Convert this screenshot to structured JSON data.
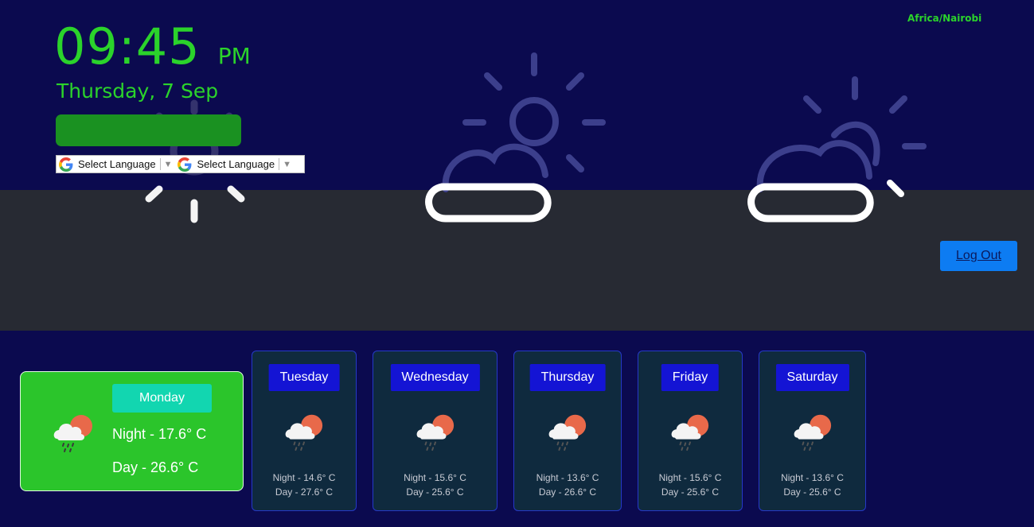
{
  "header": {
    "timezone": "Africa/Nairobi",
    "time": "09:45",
    "ampm": "PM",
    "date": "Thursday, 7 Sep"
  },
  "language": {
    "select1": "Select Language",
    "select2": "Select Language",
    "arrow": "▼"
  },
  "auth": {
    "logout_label": "Log Out"
  },
  "today": {
    "day": "Monday",
    "night": "Night - 17.6° C",
    "day_temp": "Day - 26.6° C",
    "icon": "rain-sun-cloud-icon"
  },
  "forecast": [
    {
      "day": "Tuesday",
      "night": "Night - 14.6° C",
      "day_temp": "Day - 27.6° C"
    },
    {
      "day": "Wednesday",
      "night": "Night - 15.6° C",
      "day_temp": "Day - 25.6° C"
    },
    {
      "day": "Thursday",
      "night": "Night - 13.6° C",
      "day_temp": "Day - 26.6° C"
    },
    {
      "day": "Friday",
      "night": "Night - 15.6° C",
      "day_temp": "Day - 25.6° C"
    },
    {
      "day": "Saturday",
      "night": "Night - 13.6° C",
      "day_temp": "Day - 25.6° C"
    }
  ],
  "colors": {
    "background": "#0b0a4f",
    "accent_green": "#2bd32b",
    "today_card": "#2bc52b",
    "day_label": "#1414d4",
    "logout_button": "#0d7cf2"
  }
}
